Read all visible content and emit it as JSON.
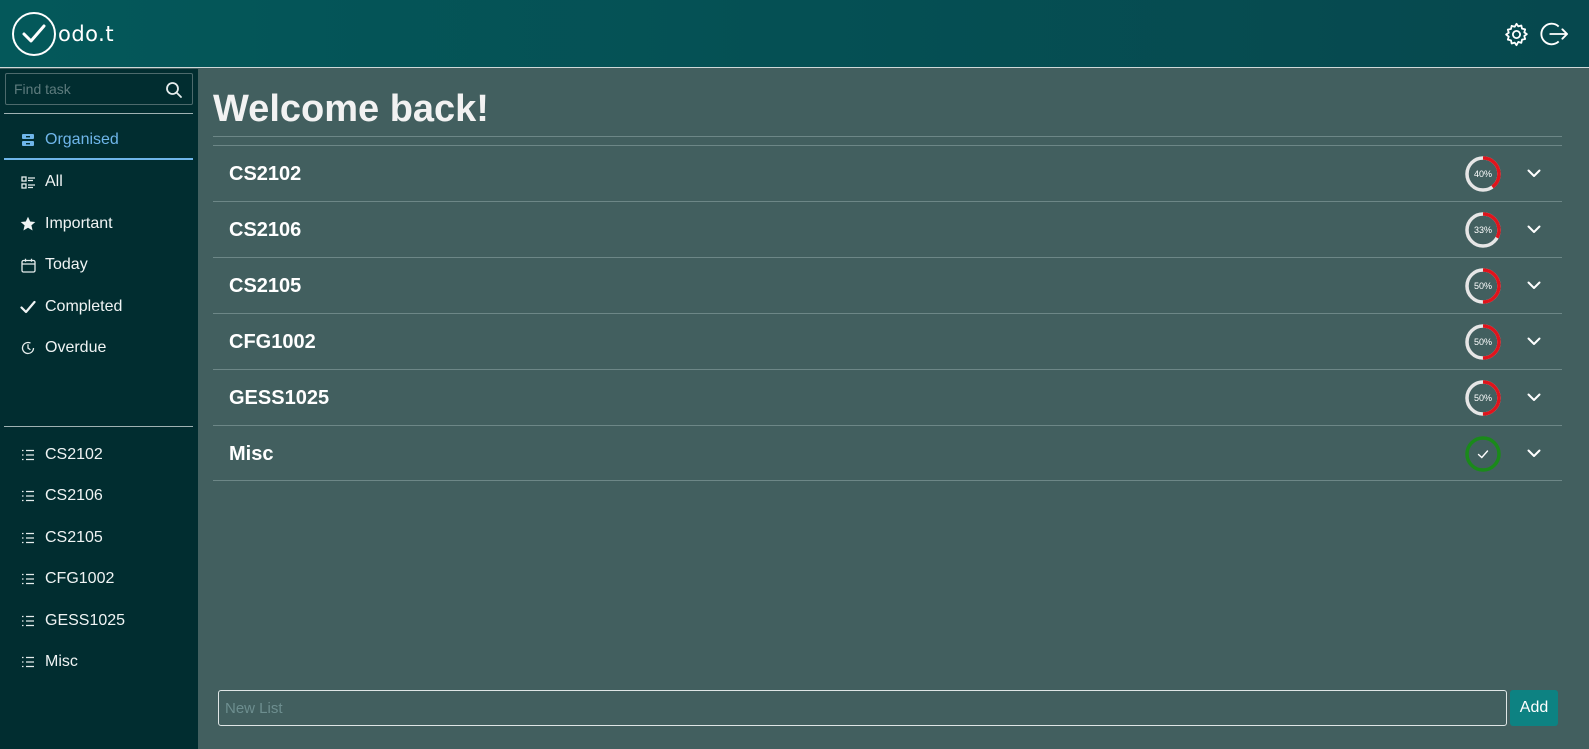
{
  "header": {
    "logo_text": "odo.t",
    "settings_icon": "gear-icon",
    "logout_icon": "logout-icon"
  },
  "sidebar": {
    "search": {
      "placeholder": "Find task",
      "value": "",
      "icon": "search-icon"
    },
    "nav": [
      {
        "label": "Organised",
        "icon": "archive-icon",
        "active": true
      },
      {
        "label": "All",
        "icon": "list-details-icon",
        "active": false
      },
      {
        "label": "Important",
        "icon": "star-icon",
        "active": false
      },
      {
        "label": "Today",
        "icon": "calendar-icon",
        "active": false
      },
      {
        "label": "Completed",
        "icon": "check-icon",
        "active": false
      },
      {
        "label": "Overdue",
        "icon": "clock-icon",
        "active": false
      }
    ],
    "lists": [
      {
        "label": "CS2102",
        "icon": "list-icon"
      },
      {
        "label": "CS2106",
        "icon": "list-icon"
      },
      {
        "label": "CS2105",
        "icon": "list-icon"
      },
      {
        "label": "CFG1002",
        "icon": "list-icon"
      },
      {
        "label": "GESS1025",
        "icon": "list-icon"
      },
      {
        "label": "Misc",
        "icon": "list-icon"
      }
    ]
  },
  "main": {
    "welcome": "Welcome back!",
    "lists": [
      {
        "title": "CS2102",
        "progress": 40,
        "progress_label": "40%",
        "complete": false
      },
      {
        "title": "CS2106",
        "progress": 33,
        "progress_label": "33%",
        "complete": false
      },
      {
        "title": "CS2105",
        "progress": 50,
        "progress_label": "50%",
        "complete": false
      },
      {
        "title": "CFG1002",
        "progress": 50,
        "progress_label": "50%",
        "complete": false
      },
      {
        "title": "GESS1025",
        "progress": 50,
        "progress_label": "50%",
        "complete": false
      },
      {
        "title": "Misc",
        "progress": 100,
        "progress_label": "",
        "complete": true
      }
    ],
    "new_list": {
      "placeholder": "New List",
      "value": ""
    },
    "add_label": "Add"
  },
  "colors": {
    "header_bg": "#04585a",
    "sidebar_bg": "#012d30",
    "main_bg": "#425f5f",
    "active": "#6fb6ea",
    "progress_done": "#e0141c",
    "progress_track": "#e6e6e6",
    "complete": "#1a8a1a",
    "add_button": "#0d8282"
  }
}
